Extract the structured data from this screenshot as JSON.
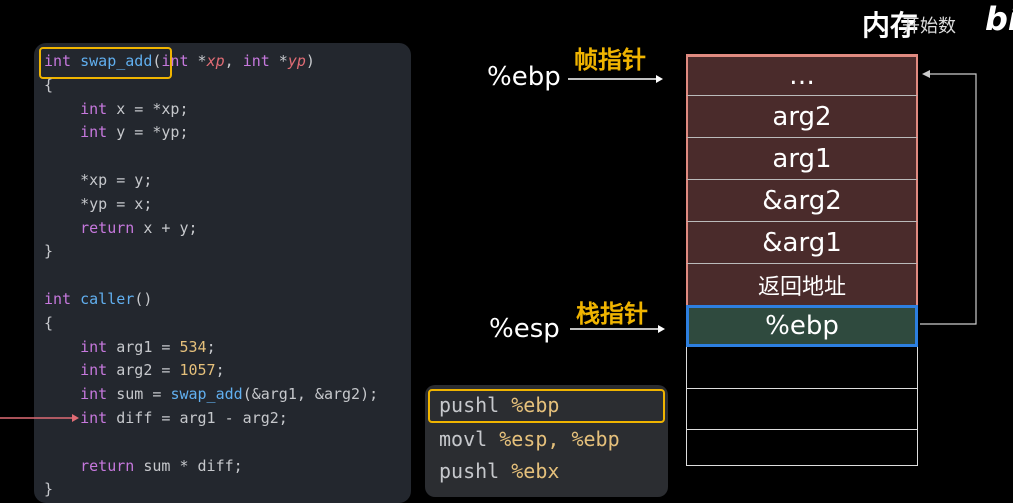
{
  "corner": {
    "title": "内存",
    "overlay": "开始数",
    "logo": "bi"
  },
  "code": {
    "lines": [
      "int swap_add(int *xp, int *yp)",
      "{",
      "    int x = *xp;",
      "    int y = *yp;",
      "",
      "    *xp = y;",
      "    *yp = x;",
      "    return x + y;",
      "}",
      "",
      "int caller()",
      "{",
      "    int arg1 = 534;",
      "    int arg2 = 1057;",
      "    int sum = swap_add(&arg1, &arg2);",
      "    int diff = arg1 - arg2;",
      "",
      "    return sum * diff;",
      "}"
    ]
  },
  "asm": {
    "lines": [
      {
        "op": "pushl ",
        "args": "%ebp"
      },
      {
        "op": "movl ",
        "args": "%esp, %ebp"
      },
      {
        "op": "pushl ",
        "args": "%ebx"
      }
    ]
  },
  "registers": {
    "ebp_label": "%ebp",
    "ebp_pointer_name": "帧指针",
    "esp_label": "%esp",
    "esp_pointer_name": "栈指针"
  },
  "stack": {
    "cells": [
      "…",
      "arg2",
      "arg1",
      "&arg2",
      "&arg1",
      "返回地址",
      "%ebp",
      "",
      "",
      ""
    ]
  },
  "colors": {
    "frame_fill": "#4a2b2b",
    "frame_border": "#e08a80",
    "current_fill": "#2f4a3e",
    "current_border": "#2d7fe0",
    "highlight": "#f0b400"
  }
}
